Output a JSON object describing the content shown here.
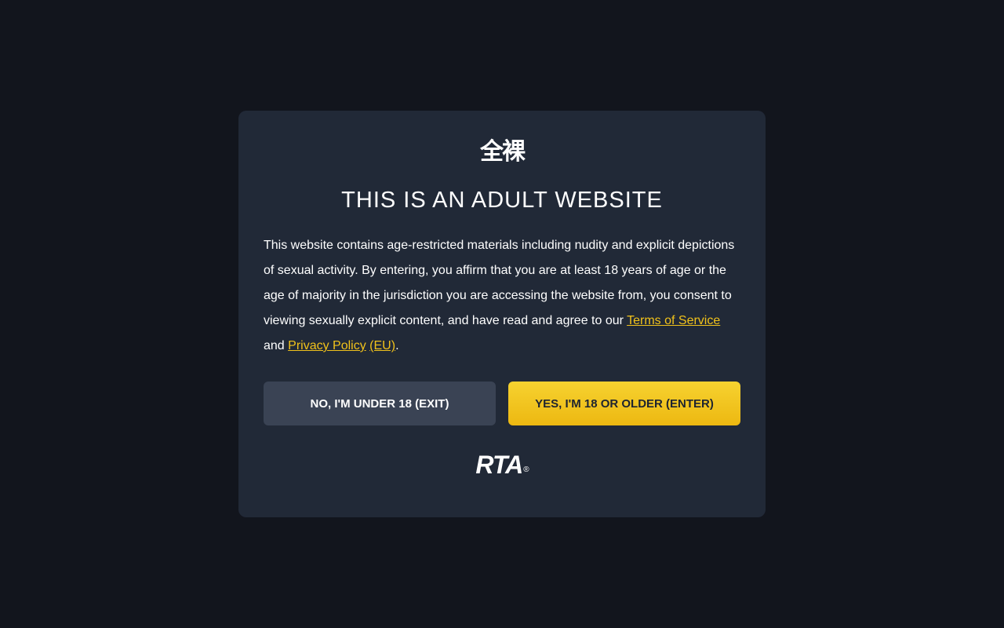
{
  "site_logo_text": "全裸",
  "dialog": {
    "title": "THIS IS AN ADULT WEBSITE",
    "body_before_tos": "This website contains age-restricted materials including nudity and explicit depictions of sexual activity. By entering, you affirm that you are at least 18 years of age or the age of majority in the jurisdiction you are accessing the website from, you consent to viewing sexually explicit content, and have read and agree to our ",
    "tos_link": "Terms of Service",
    "body_and": " and ",
    "privacy_link": "Privacy Policy",
    "space": " ",
    "eu_link": "(EU)",
    "period": "."
  },
  "buttons": {
    "exit_label": "NO, I'M UNDER 18 (EXIT)",
    "enter_label": "YES, I'M 18 OR OLDER (ENTER)"
  },
  "rta": {
    "label": "RTA",
    "mark": "®"
  },
  "colors": {
    "page_background": "#12151d",
    "dialog_background": "#212937",
    "accent_yellow": "#f1c21b",
    "exit_button": "#3a4354"
  }
}
